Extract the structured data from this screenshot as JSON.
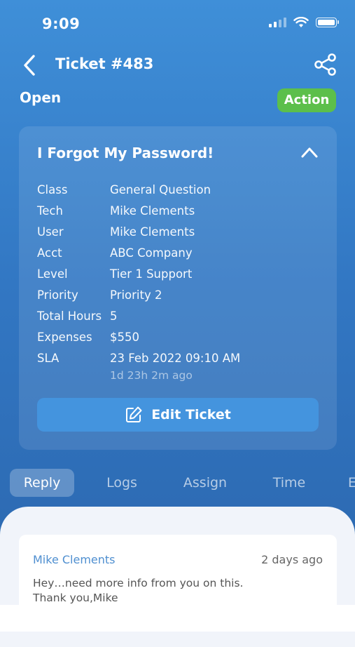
{
  "status_bar": {
    "time": "9:09"
  },
  "header": {
    "title": "Ticket #483"
  },
  "ticket_status": "Open",
  "action_label": "Action",
  "card": {
    "title": "I Forgot My Password!",
    "fields": [
      {
        "key": "Class",
        "value": "General Question"
      },
      {
        "key": "Tech",
        "value": "Mike Clements"
      },
      {
        "key": "User",
        "value": "Mike Clements"
      },
      {
        "key": "Acct",
        "value": "ABC Company"
      },
      {
        "key": "Level",
        "value": "Tier 1 Support"
      },
      {
        "key": "Priority",
        "value": "Priority 2"
      },
      {
        "key": "Total Hours",
        "value": "5"
      },
      {
        "key": "Expenses",
        "value": "$550"
      },
      {
        "key": "SLA",
        "value": "23 Feb 2022 09:10 AM"
      }
    ],
    "sla_relative": "1d 23h 2m ago",
    "edit_label": "Edit Ticket"
  },
  "tabs": [
    "Reply",
    "Logs",
    "Assign",
    "Time",
    "E"
  ],
  "message": {
    "author": "Mike Clements",
    "time": "2 days ago",
    "body": "Hey…need more info from you on this.\nThank you,Mike"
  },
  "colors": {
    "action_green": "#5cbf4b",
    "accent_blue": "#4494de",
    "link_blue": "#4f8fd0"
  }
}
